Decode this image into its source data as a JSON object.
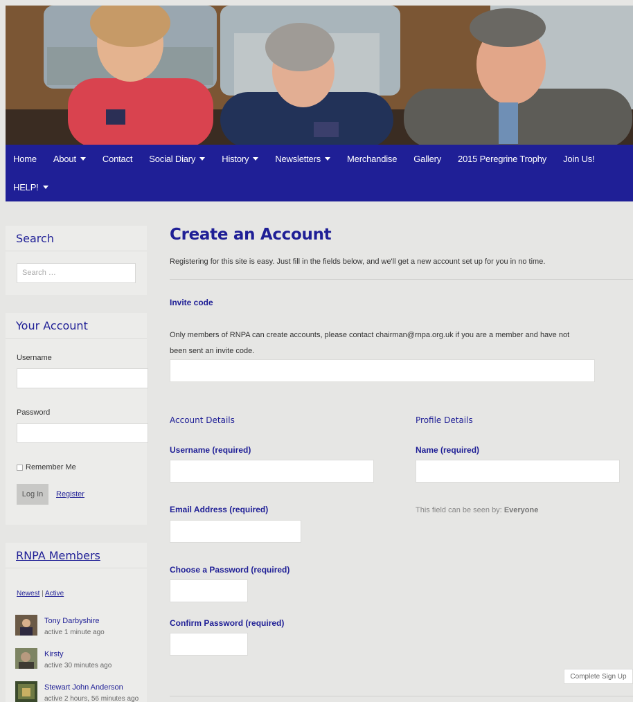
{
  "nav": {
    "row1": [
      {
        "label": "Home",
        "dropdown": false
      },
      {
        "label": "About",
        "dropdown": true
      },
      {
        "label": "Contact",
        "dropdown": false
      },
      {
        "label": "Social Diary",
        "dropdown": true
      },
      {
        "label": "History",
        "dropdown": true
      },
      {
        "label": "Newsletters",
        "dropdown": true
      },
      {
        "label": "Merchandise",
        "dropdown": false
      },
      {
        "label": "Gallery",
        "dropdown": false
      },
      {
        "label": "2015 Peregrine Trophy",
        "dropdown": false
      },
      {
        "label": "Join Us!",
        "dropdown": false
      }
    ],
    "row2": [
      {
        "label": "HELP!",
        "dropdown": true
      }
    ]
  },
  "sidebar": {
    "search": {
      "title": "Search",
      "placeholder": "Search …"
    },
    "account": {
      "title": "Your Account",
      "username_label": "Username",
      "password_label": "Password",
      "remember_label": "Remember Me",
      "login_label": "Log In",
      "register_label": "Register"
    },
    "members": {
      "title": "RNPA Members",
      "tab_newest": "Newest",
      "tab_sep": "|",
      "tab_active": "Active",
      "items": [
        {
          "name": "Tony Darbyshire",
          "active": "active 1 minute ago"
        },
        {
          "name": "Kirsty",
          "active": "active 30 minutes ago"
        },
        {
          "name": "Stewart John Anderson",
          "active": "active 2 hours, 56 minutes ago"
        }
      ]
    }
  },
  "main": {
    "title": "Create an Account",
    "intro": "Registering for this site is easy. Just fill in the fields below, and we'll get a new account set up for you in no time.",
    "invite_label": "Invite code",
    "invite_text_1": "Only members of RNPA can create accounts, please contact chairman@rnpa.org.uk if you are a member and have not",
    "invite_text_2": "been sent an invite code.",
    "account_details": "Account Details",
    "profile_details": "Profile Details",
    "username_label": "Username (required)",
    "name_label": "Name (required)",
    "email_label": "Email Address (required)",
    "visibility_prefix": "This field can be seen by:",
    "visibility_value": "Everyone",
    "password_label": "Choose a Password (required)",
    "confirm_label": "Confirm Password (required)",
    "submit_label": "Complete Sign Up"
  },
  "colors": {
    "nav": "#1f1f96",
    "accent": "#1f1f96",
    "background": "#e6e6e4"
  }
}
